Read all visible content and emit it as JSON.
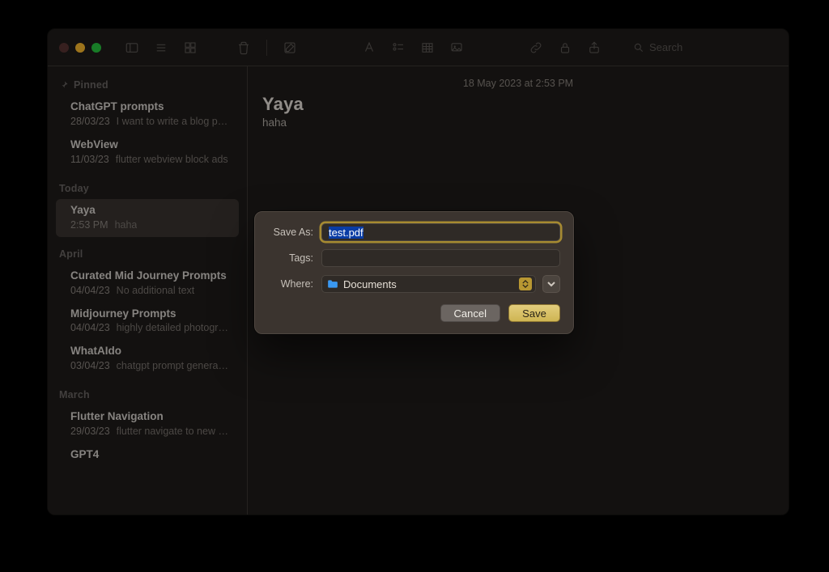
{
  "toolbar": {
    "search_placeholder": "Search"
  },
  "sidebar": {
    "pinned_label": "Pinned",
    "pinned": [
      {
        "title": "ChatGPT prompts",
        "date": "28/03/23",
        "snippet": "I want to write a blog po…"
      },
      {
        "title": "WebView",
        "date": "11/03/23",
        "snippet": "flutter webview block ads"
      }
    ],
    "sections": [
      {
        "label": "Today",
        "items": [
          {
            "title": "Yaya",
            "date": "2:53 PM",
            "snippet": "haha",
            "selected": true
          }
        ]
      },
      {
        "label": "April",
        "items": [
          {
            "title": "Curated Mid Journey Prompts",
            "date": "04/04/23",
            "snippet": "No additional text"
          },
          {
            "title": "Midjourney Prompts",
            "date": "04/04/23",
            "snippet": "highly detailed photogra…"
          },
          {
            "title": "WhatAIdo",
            "date": "03/04/23",
            "snippet": "chatgpt prompt generator"
          }
        ]
      },
      {
        "label": "March",
        "items": [
          {
            "title": "Flutter Navigation",
            "date": "29/03/23",
            "snippet": "flutter navigate to new p…"
          },
          {
            "title": "GPT4",
            "date": "",
            "snippet": ""
          }
        ]
      }
    ]
  },
  "note": {
    "timestamp": "18 May 2023 at 2:53 PM",
    "title": "Yaya",
    "body": "haha"
  },
  "save_sheet": {
    "save_as_label": "Save As:",
    "filename": "test.pdf",
    "tags_label": "Tags:",
    "tags_value": "",
    "where_label": "Where:",
    "where_value": "Documents",
    "cancel_label": "Cancel",
    "save_label": "Save"
  }
}
